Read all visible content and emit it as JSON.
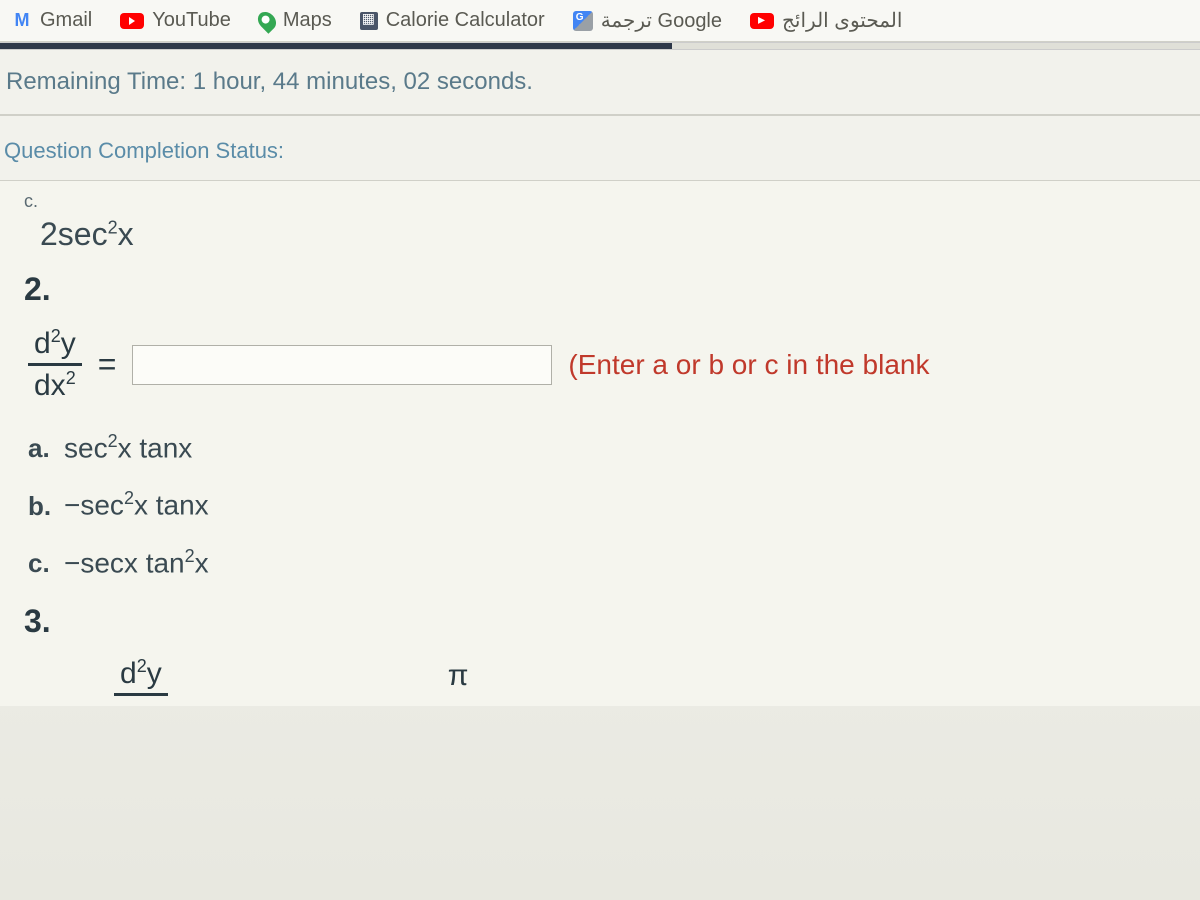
{
  "bookmarks": [
    {
      "label": "Gmail",
      "icon": "gmail-icon"
    },
    {
      "label": "YouTube",
      "icon": "youtube-icon"
    },
    {
      "label": "Maps",
      "icon": "maps-icon"
    },
    {
      "label": "Calorie Calculator",
      "icon": "calculator-icon"
    },
    {
      "label": "ترجمة Google",
      "icon": "translate-icon"
    },
    {
      "label": "المحتوى الرائج",
      "icon": "trending-icon"
    }
  ],
  "timer": {
    "label": "Remaining Time: 1 hour, 44 minutes, 02 seconds."
  },
  "status": {
    "label": "Question Completion Status:"
  },
  "question": {
    "prev_option_letter": "c.",
    "prev_answer_html": "2sec²x",
    "number": "2.",
    "fraction_top": "d²y",
    "fraction_bottom": "dx²",
    "equals": "=",
    "input_value": "",
    "hint": "(Enter a or b or c in the blank",
    "options": [
      {
        "letter": "a.",
        "math": "sec²x tanx"
      },
      {
        "letter": "b.",
        "math": "−sec²x tanx"
      },
      {
        "letter": "c.",
        "math": "−secx tan²x"
      }
    ],
    "next_number": "3.",
    "next_fraction_top": "d²y",
    "pi": "π"
  }
}
